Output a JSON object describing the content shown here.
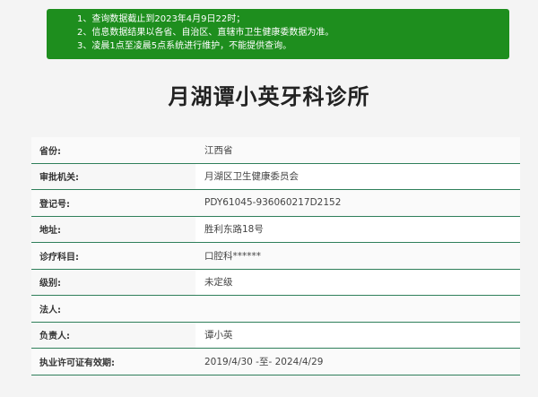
{
  "notice": {
    "lines": [
      "1、查询数据截止到2023年4月9日22时；",
      "2、信息数据结果以各省、自治区、直辖市卫生健康委数据为准。",
      "3、凌晨1点至凌晨5点系统进行维护，不能提供查询。"
    ]
  },
  "title": "月湖谭小英牙科诊所",
  "rows": [
    {
      "label": "省份:",
      "value": "江西省"
    },
    {
      "label": "审批机关:",
      "value": "月湖区卫生健康委员会"
    },
    {
      "label": "登记号:",
      "value": "PDY61045-936060217D2152"
    },
    {
      "label": "地址:",
      "value": "胜利东路18号"
    },
    {
      "label": "诊疗科目:",
      "value": "口腔科******"
    },
    {
      "label": "级别:",
      "value": "未定级"
    },
    {
      "label": "法人:",
      "value": ""
    },
    {
      "label": "负责人:",
      "value": "谭小英"
    },
    {
      "label": "执业许可证有效期:",
      "value": "2019/4/30 -至- 2024/4/29"
    }
  ]
}
